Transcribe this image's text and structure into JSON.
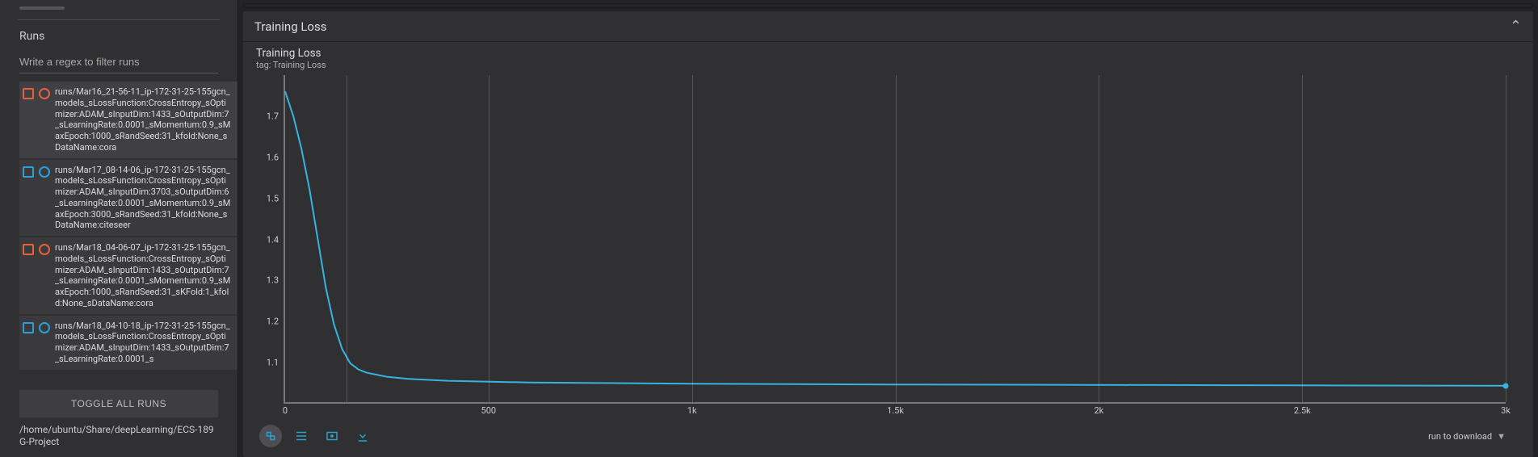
{
  "sidebar": {
    "sectionLabel": "Runs",
    "filterPlaceholder": "Write a regex to filter runs",
    "toggleAllLabel": "TOGGLE ALL RUNS",
    "logdir": "/home/ubuntu/Share/deepLearning/ECS-189G-Project",
    "runs": [
      {
        "color": "#e6613e",
        "label": "runs/Mar16_21-56-11_ip-172-31-25-155gcn_models_sLossFunction:CrossEntropy_sOptimizer:ADAM_sInputDim:1433_sOutputDim:7_sLearningRate:0.0001_sMomentum:0.9_sMaxEpoch:1000_sRandSeed:31_kfold:None_sDataName:cora",
        "highlight": true
      },
      {
        "color": "#2aa0db",
        "label": "runs/Mar17_08-14-06_ip-172-31-25-155gcn_models_sLossFunction:CrossEntropy_sOptimizer:ADAM_sInputDim:3703_sOutputDim:6_sLearningRate:0.0001_sMomentum:0.9_sMaxEpoch:3000_sRandSeed:31_kfold:None_sDataName:citeseer",
        "highlight": false
      },
      {
        "color": "#e6613e",
        "label": "runs/Mar18_04-06-07_ip-172-31-25-155gcn_models_sLossFunction:CrossEntropy_sOptimizer:ADAM_sInputDim:1433_sOutputDim:7_sLearningRate:0.0001_sMomentum:0.9_sMaxEpoch:1000_sRandSeed:31_sKFold:1_kfold:None_sDataName:cora",
        "highlight": false
      },
      {
        "color": "#2aa0db",
        "label": "runs/Mar18_04-10-18_ip-172-31-25-155gcn_models_sLossFunction:CrossEntropy_sOptimizer:ADAM_sInputDim:1433_sOutputDim:7_sLearningRate:0.0001_s",
        "highlight": false
      }
    ]
  },
  "panel": {
    "title": "Training Loss",
    "chartTitle": "Training Loss",
    "tagLine": "tag: Training Loss",
    "runDownloadLabel": "run to download"
  },
  "chart_data": {
    "type": "line",
    "title": "Training Loss",
    "xlabel": "",
    "ylabel": "",
    "xlim": [
      0,
      3000
    ],
    "ylim": [
      1.0,
      1.8
    ],
    "yticks": [
      1.1,
      1.2,
      1.3,
      1.4,
      1.5,
      1.6,
      1.7
    ],
    "xticks": [
      0,
      500,
      1000,
      1500,
      2000,
      2500,
      3000
    ],
    "xtick_labels": [
      "0",
      "500",
      "1k",
      "1.5k",
      "2k",
      "2.5k",
      "3k"
    ],
    "gridlines_x": [
      150,
      500,
      1000,
      1500,
      2000,
      2500,
      3000
    ],
    "series": [
      {
        "name": "citeseer (Mar17_08-14-06)",
        "color": "#35b4e0",
        "x": [
          0,
          20,
          40,
          60,
          80,
          100,
          120,
          140,
          160,
          180,
          200,
          250,
          300,
          400,
          600,
          1000,
          1500,
          2000,
          2500,
          3000
        ],
        "y": [
          1.76,
          1.7,
          1.62,
          1.52,
          1.4,
          1.28,
          1.19,
          1.13,
          1.095,
          1.08,
          1.072,
          1.062,
          1.057,
          1.052,
          1.048,
          1.045,
          1.043,
          1.042,
          1.041,
          1.04
        ]
      }
    ]
  }
}
